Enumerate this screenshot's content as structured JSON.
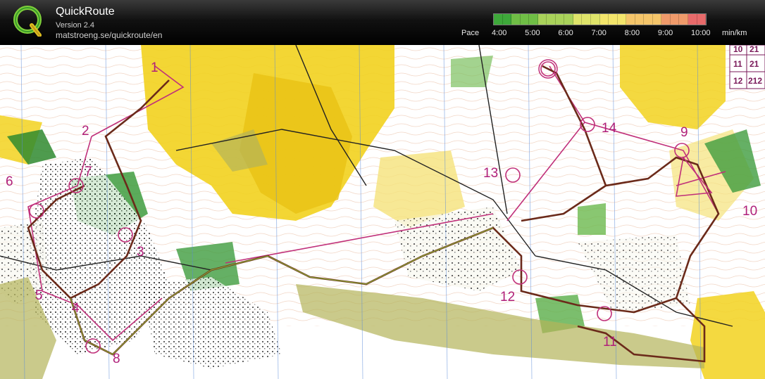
{
  "header": {
    "app_title": "QuickRoute",
    "version": "Version 2.4",
    "url": "matstroeng.se/quickroute/en",
    "logo_letter": "Q"
  },
  "pace": {
    "label": "Pace",
    "ticks": [
      "4:00",
      "5:00",
      "6:00",
      "7:00",
      "8:00",
      "9:00",
      "10:00"
    ],
    "unit": "min/km",
    "gradient_colors": [
      "#3ea83a",
      "#6fbe45",
      "#a9d25a",
      "#dfe46a",
      "#f3e56b",
      "#f4c56a",
      "#ef9a6a",
      "#e86a6a"
    ]
  },
  "map": {
    "controls": [
      {
        "num": "1"
      },
      {
        "num": "2"
      },
      {
        "num": "3"
      },
      {
        "num": "4"
      },
      {
        "num": "5"
      },
      {
        "num": "6"
      },
      {
        "num": "7"
      },
      {
        "num": "8"
      },
      {
        "num": "9"
      },
      {
        "num": "10"
      },
      {
        "num": "11"
      },
      {
        "num": "12"
      },
      {
        "num": "13"
      },
      {
        "num": "14"
      },
      {
        "num": "11"
      },
      {
        "num": "12"
      }
    ],
    "control_table": [
      {
        "num": "10",
        "val": "21"
      },
      {
        "num": "11",
        "val": "21"
      },
      {
        "num": "12",
        "val": "212"
      }
    ],
    "colors": {
      "route": "#6b2a1a",
      "course": "#c0307a",
      "yellow": "#f2d21e",
      "green": "#3e9c3e",
      "olive": "#b4b45a"
    }
  }
}
